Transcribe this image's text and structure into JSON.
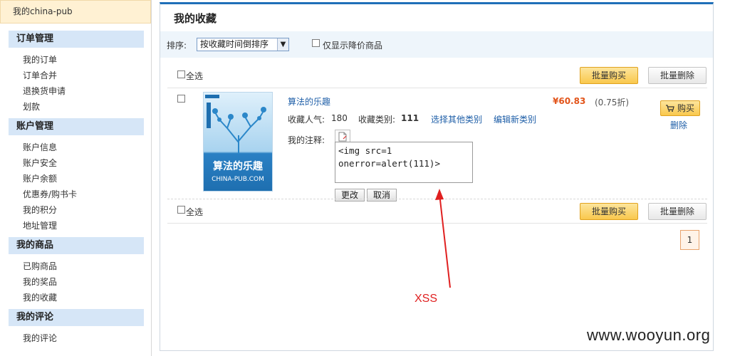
{
  "sidebar": {
    "user_header": "我的china-pub",
    "sections": [
      {
        "title": "订单管理",
        "items": [
          "我的订单",
          "订单合并",
          "退换货申请",
          "划款"
        ]
      },
      {
        "title": "账户管理",
        "items": [
          "账户信息",
          "账户安全",
          "账户余额",
          "优惠券/购书卡",
          "我的积分",
          "地址管理"
        ]
      },
      {
        "title": "我的商品",
        "items": [
          "已购商品",
          "我的奖品",
          "我的收藏"
        ]
      },
      {
        "title": "我的评论",
        "items": [
          "我的评论"
        ]
      }
    ]
  },
  "main": {
    "title": "我的收藏",
    "filter": {
      "sort_label": "排序:",
      "sort_value": "按收藏时间倒排序",
      "price_drop_label": "仅显示降价商品"
    },
    "select_all_label": "全选",
    "batch_buy_label": "批量购买",
    "batch_delete_label": "批量删除",
    "item": {
      "title": "算法的乐趣",
      "popularity_label": "收藏人气:",
      "popularity_value": "180",
      "category_label": "收藏类别:",
      "category_value": "111",
      "choose_other_category": "选择其他类别",
      "edit_new_category": "编辑新类别",
      "price": "¥60.83",
      "discount": "(0.75折)",
      "buy_label": "购买",
      "delete_label": "删除",
      "note_label": "我的注释:",
      "note_value": "<img src=1\nonerror=alert(111)>",
      "save_label": "更改",
      "cancel_label": "取消",
      "cover_title": "算法的乐趣",
      "cover_subtitle": "CHINA-PUB.COM"
    },
    "pagination": {
      "current": "1"
    }
  },
  "annotation": {
    "xss_label": "XSS",
    "arrow_color": "#e02020"
  },
  "watermark": "www.wooyun.org"
}
